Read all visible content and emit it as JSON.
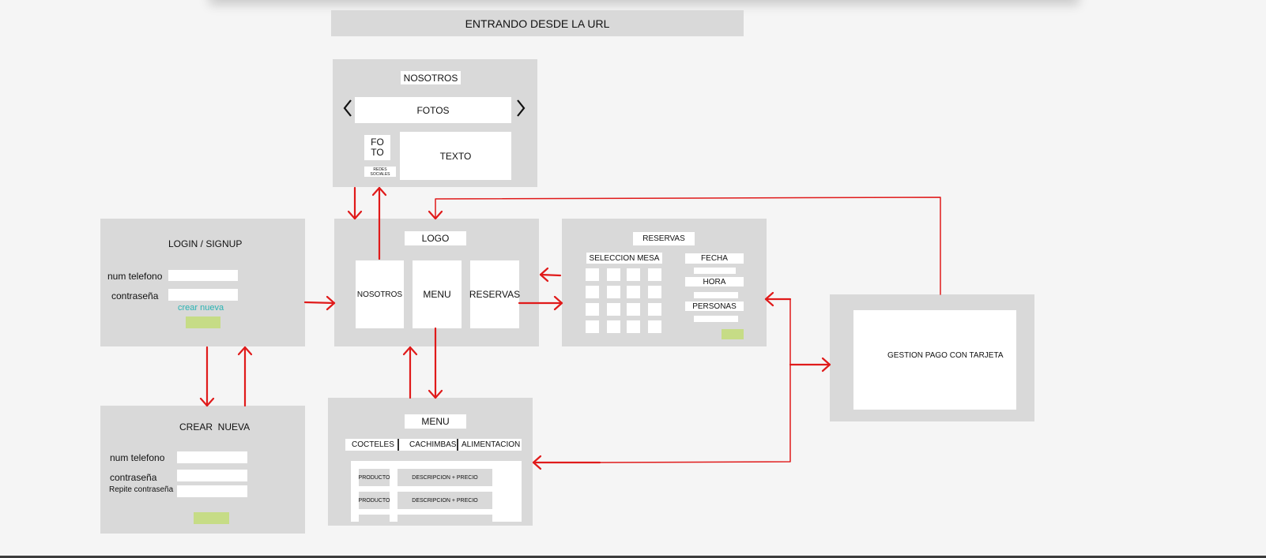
{
  "colors": {
    "panel": "#d9d9d9",
    "arrow": "#e01a1a",
    "link": "#29b3b3",
    "button": "#c6dc86"
  },
  "header": {
    "title": "ENTRANDO DESDE LA URL"
  },
  "nosotros": {
    "title": "NOSOTROS",
    "photos": "FOTOS",
    "photo_line1": "FO",
    "photo_line2": "TO",
    "text": "TEXTO",
    "social": "REDES SOCIALES",
    "prev_icon": "chevron-left-icon",
    "next_icon": "chevron-right-icon"
  },
  "login": {
    "title": "LOGIN / SIGNUP",
    "phone_label": "num telefono",
    "password_label": "contraseña",
    "create_link": "crear nueva"
  },
  "home": {
    "logo": "LOGO",
    "nosotros": "NOSOTROS",
    "menu": "MENU",
    "reservas": "RESERVAS"
  },
  "reservas": {
    "title": "RESERVAS",
    "table_select": "SELECCION MESA",
    "date": "FECHA",
    "time": "HORA",
    "people": "PERSONAS"
  },
  "payment": {
    "label": "GESTION PAGO CON TARJETA"
  },
  "crear": {
    "title": "CREAR  NUEVA",
    "phone_label": "num telefono",
    "password_label": "contraseña",
    "repeat_label": "Repite contraseña"
  },
  "menu": {
    "title": "MENU",
    "tabs": [
      "COCTELES",
      "CACHIMBAS",
      "ALIMENTACION"
    ],
    "rows": [
      {
        "product": "PRODUCTO",
        "description": "DESCRIPCION + PRECIO"
      },
      {
        "product": "PRODUCTO",
        "description": "DESCRIPCION + PRECIO"
      }
    ]
  }
}
